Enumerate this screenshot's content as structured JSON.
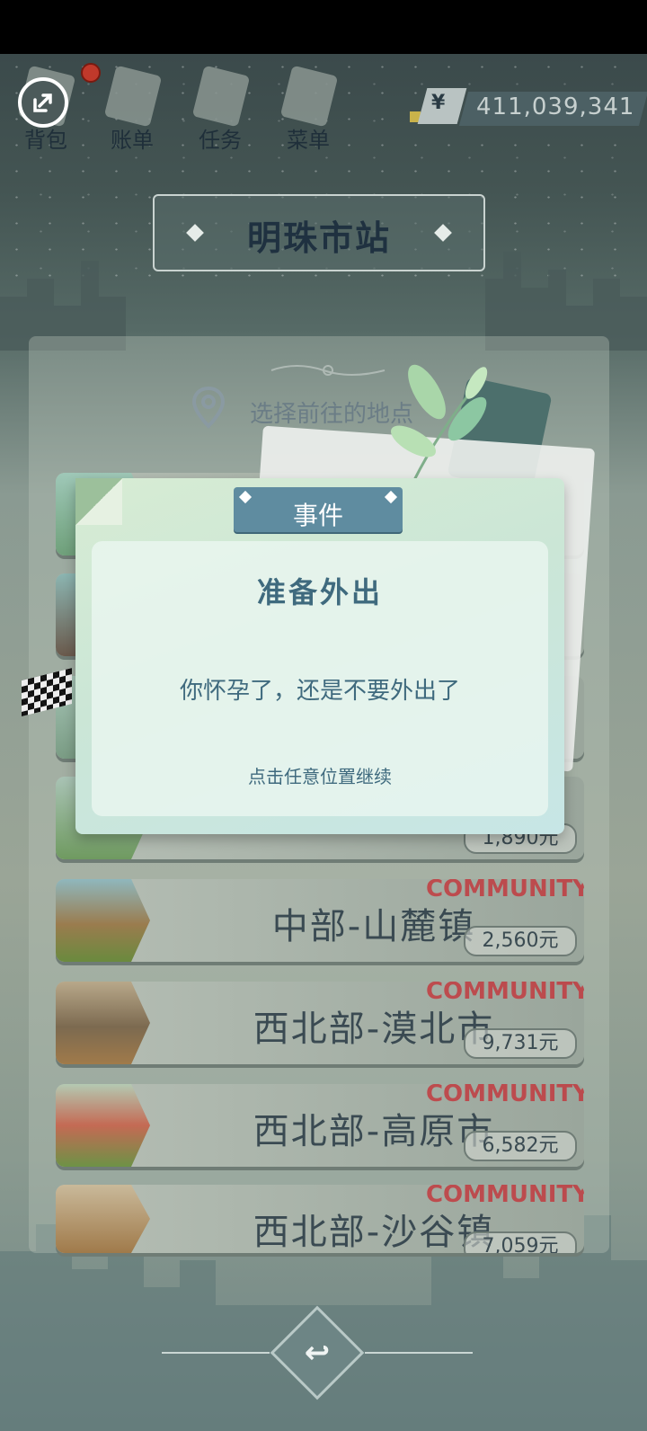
{
  "topnav": {
    "items": [
      {
        "label": "背包",
        "icon": "bag-icon"
      },
      {
        "label": "账单",
        "icon": "bill-icon"
      },
      {
        "label": "任务",
        "icon": "task-icon"
      },
      {
        "label": "菜单",
        "icon": "menu-icon"
      }
    ],
    "currency_symbol": "¥",
    "money": "411,039,341"
  },
  "station": {
    "title": "明珠市站"
  },
  "select_prompt": "选择前往的地点",
  "destinations": [
    {
      "name": "中部-山麓镇",
      "price": "2,560元",
      "watermark": "COMMUNITY"
    },
    {
      "name": "西北部-漠北市",
      "price": "9,731元",
      "watermark": "COMMUNITY"
    },
    {
      "name": "西北部-高原市",
      "price": "6,582元",
      "watermark": "COMMUNITY"
    },
    {
      "name": "西北部-沙谷镇",
      "price": "7,059元",
      "watermark": "COMMUNITY"
    }
  ],
  "partial_price": "1,890元",
  "event": {
    "tab": "事件",
    "title": "准备外出",
    "message": "你怀孕了，还是不要外出了",
    "hint": "点击任意位置继续"
  },
  "colors": {
    "dialog_tab": "#5f8ca0",
    "dialog_text": "#3f6a7e",
    "badge": "#c0392b"
  }
}
